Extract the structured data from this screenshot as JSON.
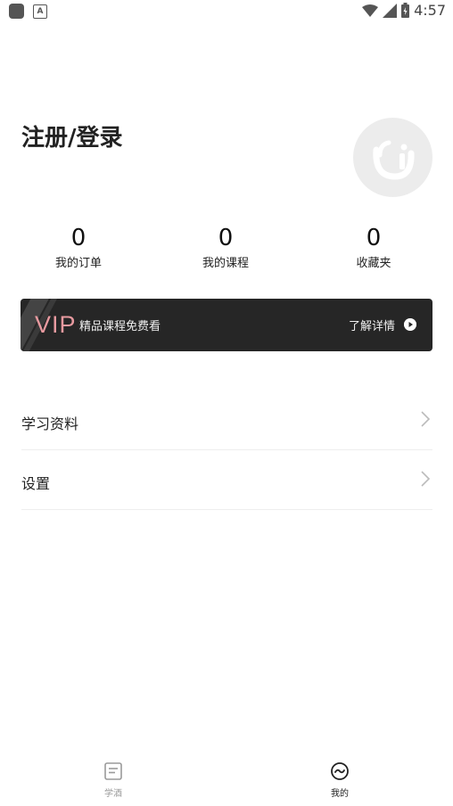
{
  "status_bar": {
    "time": "4:57",
    "left_icon_letter": "A"
  },
  "header": {
    "login_label": "注册/登录",
    "avatar_icon": "user-avatar-placeholder"
  },
  "stats": [
    {
      "value": "0",
      "label": "我的订单"
    },
    {
      "value": "0",
      "label": "我的课程"
    },
    {
      "value": "0",
      "label": "收藏夹"
    }
  ],
  "vip_banner": {
    "tag": "VIP",
    "text": "精品课程免费看",
    "more": "了解详情",
    "tag_color": "#e89aa0"
  },
  "menu": [
    {
      "label": "学习资料"
    },
    {
      "label": "设置"
    }
  ],
  "tabbar": {
    "tabs": [
      {
        "label": "学酒",
        "icon": "note-icon"
      },
      {
        "label": "我的",
        "icon": "face-icon"
      }
    ]
  }
}
